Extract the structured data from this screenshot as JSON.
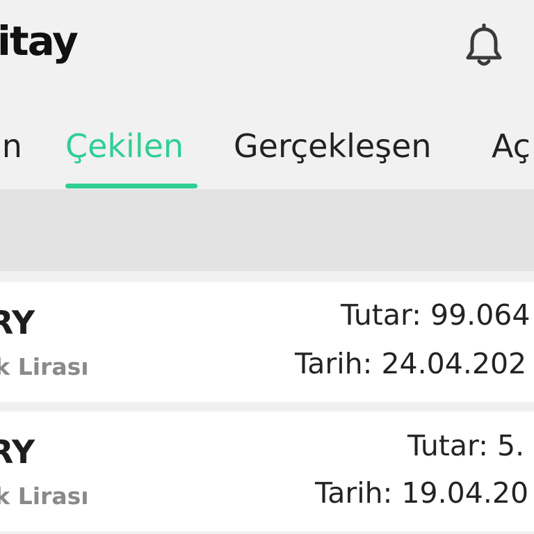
{
  "header": {
    "logo_text": "itay",
    "notification_icon": "bell-icon"
  },
  "tabs": [
    {
      "label": "ın",
      "active": false
    },
    {
      "label": "Çekilen",
      "active": true
    },
    {
      "label": "Gerçekleşen",
      "active": false
    },
    {
      "label": "Aç",
      "active": false
    }
  ],
  "colors": {
    "accent": "#2fcf94",
    "background": "#f1f1f1",
    "band": "#e3e3e3",
    "card": "#ffffff"
  },
  "cards": [
    {
      "code": "RY",
      "name": "rk Lirası",
      "amount": "Tutar: 99.064",
      "date": "Tarih: 24.04.202"
    },
    {
      "code": "RY",
      "name": "rk Lirası",
      "amount": "Tutar: 5.",
      "date": "Tarih: 19.04.20"
    }
  ]
}
